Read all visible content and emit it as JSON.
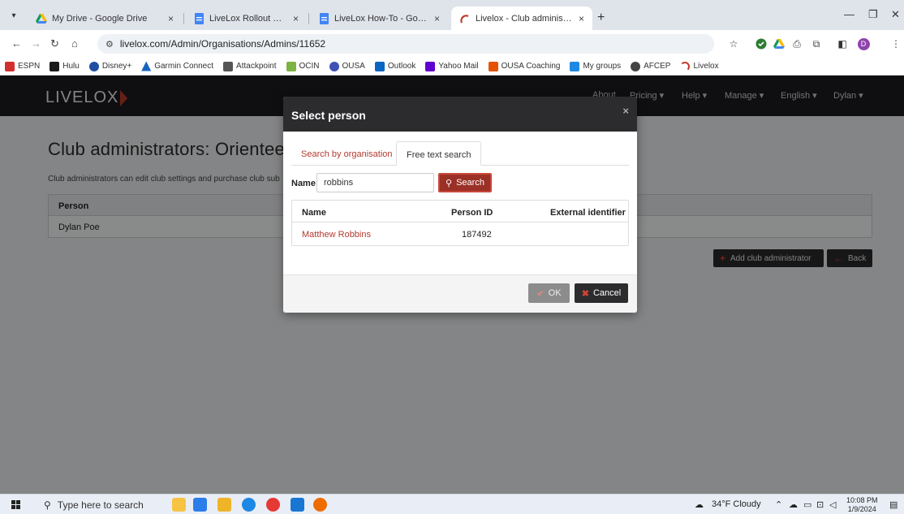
{
  "browser": {
    "tabs": [
      {
        "title": "My Drive - Google Drive",
        "active": false
      },
      {
        "title": "LiveLox Rollout Brainstorming -",
        "active": false
      },
      {
        "title": "LiveLox How-To - Google Docs",
        "active": false
      },
      {
        "title": "Livelox - Club administrators: O",
        "active": true
      }
    ],
    "tab_close": "×",
    "new_tab": "+",
    "url": "livelox.com/Admin/Organisations/Admins/11652",
    "bookmarks": [
      "ESPN",
      "Hulu",
      "Disney+",
      "Garmin Connect",
      "Attackpoint",
      "OCIN",
      "OUSA",
      "Outlook",
      "Yahoo Mail",
      "OUSA Coaching",
      "My groups",
      "AFCEP",
      "Livelox"
    ],
    "profile_initial": "D"
  },
  "site": {
    "logo": "LIVELOX",
    "nav": [
      "About",
      "Pricing ▾",
      "Help ▾",
      "Manage ▾",
      "English ▾",
      "Dylan ▾"
    ],
    "title": "Club administrators: Orienteeri",
    "description": "Club administrators can edit club settings and purchase club sub",
    "table": {
      "header": "Person",
      "rows": [
        "Dylan Poe"
      ]
    },
    "add_admin_label": "Add club administrator",
    "back_label": "Back"
  },
  "modal": {
    "title": "Select person",
    "close": "×",
    "tabs": [
      "Search by organisation",
      "Free text search"
    ],
    "name_label": "Name",
    "name_value": "robbins",
    "search_label": "Search",
    "columns": [
      "Name",
      "Person ID",
      "External identifier"
    ],
    "results": [
      {
        "name": "Matthew Robbins",
        "person_id": "187492",
        "external_id": ""
      }
    ],
    "ok_label": "OK",
    "cancel_label": "Cancel"
  },
  "taskbar": {
    "search_placeholder": "Type here to search",
    "weather": "34°F  Cloudy",
    "time": "10:08 PM",
    "date": "1/9/2024"
  },
  "colors": {
    "accent": "#b33a2e",
    "nav_bg": "#1d1d1f",
    "search_btn": "#9b3027"
  }
}
